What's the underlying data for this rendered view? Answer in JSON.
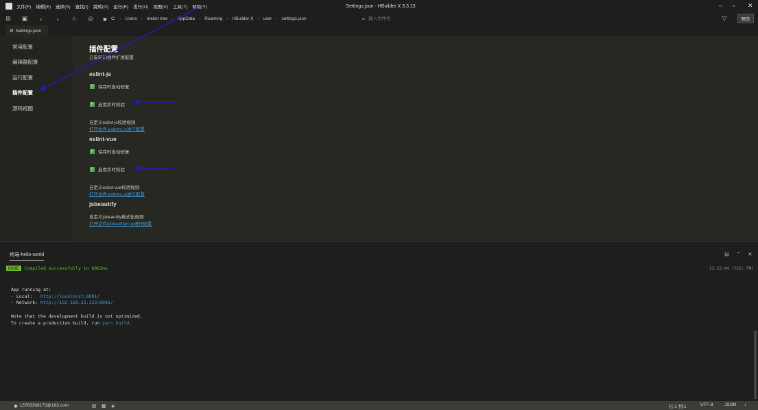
{
  "window": {
    "title": "Settings.json - HBuilder X 3.3.13"
  },
  "menu": [
    {
      "label": "文件(F)"
    },
    {
      "label": "编辑(E)"
    },
    {
      "label": "选择(S)"
    },
    {
      "label": "查找(I)"
    },
    {
      "label": "跳转(G)"
    },
    {
      "label": "运行(R)"
    },
    {
      "label": "发行(U)"
    },
    {
      "label": "视图(V)"
    },
    {
      "label": "工具(T)"
    },
    {
      "label": "帮助(Y)"
    }
  ],
  "breadcrumb": [
    "C:",
    "Users",
    "melon tree",
    "AppData",
    "Roaming",
    "HBuilder X",
    "user",
    "settings.json"
  ],
  "search": {
    "placeholder": "输入文件名"
  },
  "toolbar": {
    "preview_label": "预览"
  },
  "tab": {
    "label": "Settings.json"
  },
  "sidebar": {
    "items": [
      {
        "label": "常用配置"
      },
      {
        "label": "编辑器配置"
      },
      {
        "label": "运行配置"
      },
      {
        "label": "插件配置"
      },
      {
        "label": "源码视图"
      }
    ]
  },
  "settings": {
    "title": "插件配置",
    "subtitle": "已安装的插件扩展配置",
    "eslint_js": {
      "heading": "eslint-js",
      "fix_on_save": "保存时自动修复",
      "realtime": "启用实时校验",
      "custom_text": "自定义eslint-js校验规则",
      "link": "打开文件.eslintrc.js进行配置"
    },
    "eslint_vue": {
      "heading": "eslint-vue",
      "fix_on_save": "保存时自动修复",
      "realtime": "启用实时校验",
      "custom_text": "自定义eslint-vue校验规则",
      "link": "打开文件.eslintrc.js进行配置"
    },
    "jsbeautify": {
      "heading": "jsbeautify",
      "custom_text": "自定义jsbeautify格式化规则",
      "link": "打开文件jsbeautifyrc.js进行配置"
    }
  },
  "terminal": {
    "tab_label": "终端-hello-world",
    "done_badge": "DONE",
    "done_message": "Compiled successfully in 6063ms",
    "timestamp": "12:33:44 |F10: PM|",
    "line_app_running": "App running at:",
    "line_local_prefix": "- Local:   ",
    "line_local_url": "http://localhost:8081/",
    "line_network_prefix": "- Network: ",
    "line_network_url": "http://192.168.23.123:8081/",
    "line_note": "Note that the development build is not optimized.",
    "line_prod_prefix": "To create a production build, run ",
    "line_prod_cmd": "yarn build",
    "line_prod_suffix": "."
  },
  "statusbar": {
    "user": "13783308172@163.com",
    "position": "行:1  列:1",
    "encoding": "UTF-8",
    "language": "JSON"
  },
  "colors": {
    "accent_link": "#3c9be0",
    "checkbox": "#4caf50",
    "done": "#6abe30",
    "annotation_arrow": "#1a1ad6"
  }
}
